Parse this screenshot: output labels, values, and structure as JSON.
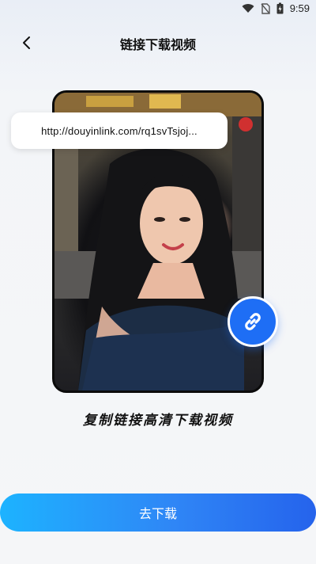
{
  "status_bar": {
    "time": "9:59",
    "icons": [
      "wifi-icon",
      "no-sim-icon",
      "battery-charging-icon"
    ]
  },
  "header": {
    "title": "链接下载视频",
    "back_icon": "chevron-left-icon"
  },
  "hero": {
    "link_text": "http://douyinlink.com/rq1svTsjoj...",
    "badge_icon": "link-icon"
  },
  "caption": "复制链接高清下载视频",
  "cta": {
    "label": "去下载"
  },
  "colors": {
    "accent": "#1e6ef5",
    "cta_start": "#1db3ff",
    "cta_end": "#2563ec"
  }
}
